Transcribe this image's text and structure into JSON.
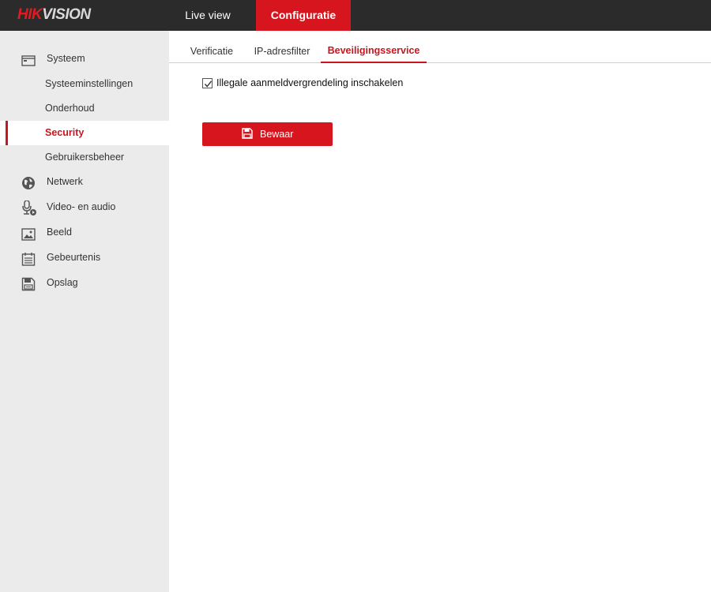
{
  "header": {
    "logo_part1": "HIK",
    "logo_part2": "VISION",
    "nav": [
      {
        "label": "Live view"
      },
      {
        "label": "Configuratie"
      }
    ]
  },
  "sidebar": {
    "systeem": {
      "label": "Systeem",
      "icon": "monitor-icon"
    },
    "sub_items": [
      {
        "label": "Systeeminstellingen"
      },
      {
        "label": "Onderhoud"
      },
      {
        "label": "Security"
      },
      {
        "label": "Gebruikersbeheer"
      }
    ],
    "items": [
      {
        "label": "Netwerk",
        "icon": "globe-icon"
      },
      {
        "label": "Video- en audio",
        "icon": "microphone-icon"
      },
      {
        "label": "Beeld",
        "icon": "image-icon"
      },
      {
        "label": "Gebeurtenis",
        "icon": "calendar-icon"
      },
      {
        "label": "Opslag",
        "icon": "storage-icon"
      }
    ]
  },
  "tabs": [
    {
      "label": "Verificatie"
    },
    {
      "label": "IP-adresfilter"
    },
    {
      "label": "Beveiligingsservice"
    }
  ],
  "content": {
    "checkbox_label": "Illegale aanmeldvergrendeling inschakelen",
    "checkbox_checked": true,
    "save_label": "Bewaar"
  },
  "colors": {
    "accent": "#d7151f",
    "topbar": "#2b2b2b",
    "sidebar": "#ebebeb"
  }
}
